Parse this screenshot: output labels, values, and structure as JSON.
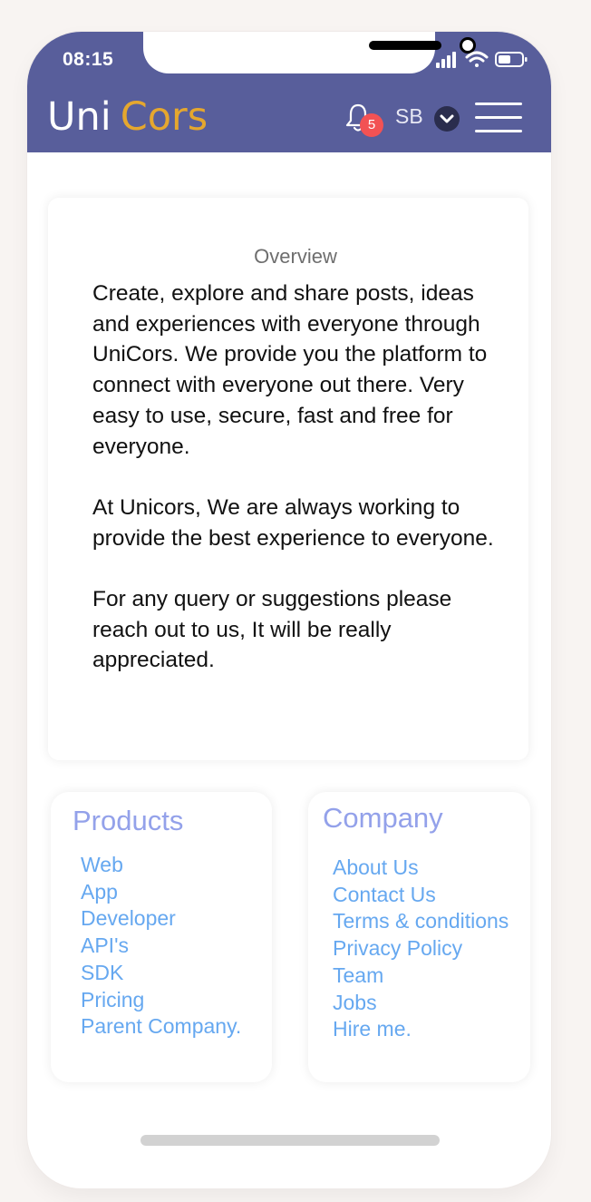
{
  "status_bar": {
    "time": "08:15",
    "icons": [
      "signal-icon",
      "wifi-icon",
      "battery-icon"
    ]
  },
  "header": {
    "logo_primary": "Uni",
    "logo_secondary": "Cors",
    "notifications_count": "5",
    "user_initials": "SB",
    "icons": [
      "bell-icon",
      "chevron-down-icon",
      "hamburger-menu-icon"
    ]
  },
  "overview": {
    "title": "Overview",
    "paragraphs": [
      "Create, explore and share posts, ideas and experiences with everyone through UniCors. We provide you the platform to connect with everyone out there. Very easy to use, secure, fast and free for everyone.",
      "At Unicors, We are always working to provide the best experience to everyone.",
      "For any query or suggestions please reach out to us, It will be really appreciated."
    ]
  },
  "products": {
    "heading": "Products",
    "links": [
      "Web",
      "App",
      "Developer",
      "API's",
      "SDK",
      "Pricing",
      "Parent Company."
    ]
  },
  "company": {
    "heading": "Company",
    "links": [
      "About Us",
      "Contact Us",
      "Terms & conditions",
      "Privacy Policy",
      "Team",
      "Jobs",
      "Hire me."
    ]
  },
  "colors": {
    "header_bg": "#585e9b",
    "logo_accent": "#e5a72e",
    "badge": "#f25254",
    "card_heading": "#93a1ea",
    "link": "#66a8f0"
  }
}
